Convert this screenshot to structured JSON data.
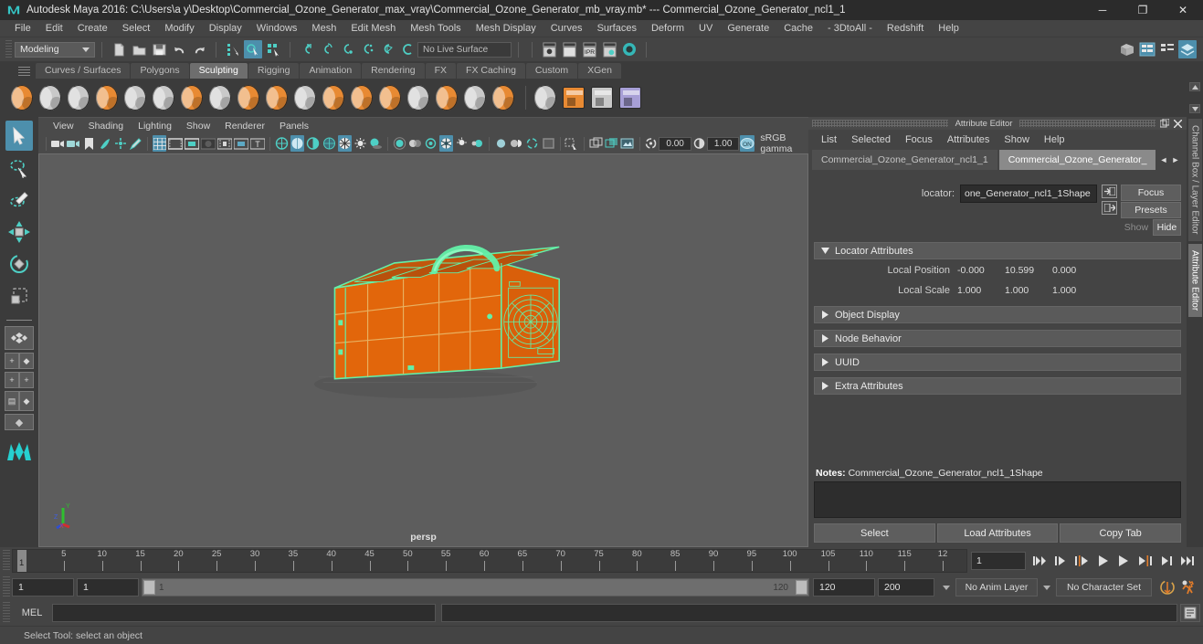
{
  "titlebar": {
    "app_icon": "maya-logo-icon",
    "title": "Autodesk Maya 2016: C:\\Users\\a y\\Desktop\\Commercial_Ozone_Generator_max_vray\\Commercial_Ozone_Generator_mb_vray.mb*  ---  Commercial_Ozone_Generator_ncl1_1",
    "minimize": "─",
    "maximize": "❐",
    "close": "✕"
  },
  "menubar": {
    "items": [
      "File",
      "Edit",
      "Create",
      "Select",
      "Modify",
      "Display",
      "Windows",
      "Mesh",
      "Edit Mesh",
      "Mesh Tools",
      "Mesh Display",
      "Curves",
      "Surfaces",
      "Deform",
      "UV",
      "Generate",
      "Cache",
      "- 3DtoAll -",
      "Redshift",
      "Help"
    ]
  },
  "statusline": {
    "mode": "Modeling",
    "live_surface": "No Live Surface",
    "icons": [
      "new-scene-icon",
      "open-scene-icon",
      "save-scene-icon",
      "undo-icon",
      "redo-icon",
      "select-hierarchy-icon",
      "select-object-icon",
      "select-component-icon",
      "snap-grid-icon",
      "snap-curve-icon",
      "snap-point-icon",
      "snap-projected-icon",
      "snap-view-plane-icon",
      "make-live-icon",
      "render-view-icon",
      "render-current-frame-icon",
      "ipr-render-icon",
      "render-settings-icon",
      "hypershade-icon",
      "show-hide-editors-icon",
      "channel-box-icon",
      "attribute-editor-icon",
      "tool-settings-icon"
    ]
  },
  "shelf": {
    "tabs": [
      "Curves / Surfaces",
      "Polygons",
      "Sculpting",
      "Rigging",
      "Animation",
      "Rendering",
      "FX",
      "FX Caching",
      "Custom",
      "XGen"
    ],
    "active_tab": "Sculpting",
    "tools": [
      {
        "name": "sculpt-brush-icon",
        "color": "#e88a33"
      },
      {
        "name": "smooth-brush-icon",
        "color": "#c9c9c9"
      },
      {
        "name": "relax-brush-icon",
        "color": "#c9c9c9"
      },
      {
        "name": "grab-brush-icon",
        "color": "#e88a33"
      },
      {
        "name": "pinch-brush-icon",
        "color": "#c9c9c9"
      },
      {
        "name": "flatten-brush-icon",
        "color": "#c9c9c9"
      },
      {
        "name": "foamy-brush-icon",
        "color": "#e88a33"
      },
      {
        "name": "spray-brush-icon",
        "color": "#c9c9c9"
      },
      {
        "name": "repeat-brush-icon",
        "color": "#e88a33"
      },
      {
        "name": "imprint-brush-icon",
        "color": "#e88a33"
      },
      {
        "name": "wax-brush-icon",
        "color": "#c9c9c9"
      },
      {
        "name": "scrape-brush-icon",
        "color": "#e88a33"
      },
      {
        "name": "fill-brush-icon",
        "color": "#e88a33"
      },
      {
        "name": "knife-brush-icon",
        "color": "#e88a33"
      },
      {
        "name": "smear-brush-icon",
        "color": "#c9c9c9"
      },
      {
        "name": "bulge-brush-icon",
        "color": "#e88a33"
      },
      {
        "name": "amplify-brush-icon",
        "color": "#c9c9c9"
      },
      {
        "name": "freeze-brush-icon",
        "color": "#e88a33"
      },
      {
        "name": "convert-sculpt-icon",
        "color": "#c9c9c9"
      },
      {
        "name": "sculpt-settings-icon",
        "color": "#e88a33"
      },
      {
        "name": "mirror-sculpt-icon",
        "color": "#c9c9c9"
      },
      {
        "name": "sculpt-layers-icon",
        "color": "#a79fd6"
      }
    ]
  },
  "toolbox": {
    "items": [
      {
        "name": "select-tool",
        "active": true
      },
      {
        "name": "lasso-select-tool",
        "active": false
      },
      {
        "name": "paint-select-tool",
        "active": false
      },
      {
        "name": "move-tool",
        "active": false
      },
      {
        "name": "rotate-tool",
        "active": false
      },
      {
        "name": "scale-tool",
        "active": false
      }
    ],
    "layouts": [
      "single-perspective-layout",
      "four-view-layout",
      "outliner-persp-layout",
      "persp-graph-layout",
      "hypershade-persp-layout",
      "two-stacked-layout",
      "maya-logo-watermark"
    ]
  },
  "viewport": {
    "menus": [
      "View",
      "Shading",
      "Lighting",
      "Show",
      "Renderer",
      "Panels"
    ],
    "exposure": "0.00",
    "gamma_value": "1.00",
    "color_space": "sRGB gamma",
    "camera_label": "persp",
    "axis": {
      "x": "X",
      "y": "Y",
      "z": "Z"
    },
    "model_colors": {
      "surface": "#e2660b",
      "wireframe": "#63f0a8",
      "background": "#5d5d5d"
    },
    "toolbar_icons": [
      "select-camera-icon",
      "lock-camera-icon",
      "bookmark-icon",
      "image-plane-icon",
      "two-d-pan-zoom-icon",
      "grease-pencil-icon",
      "grid-toggle-icon",
      "film-gate-icon",
      "resolution-gate-icon",
      "gate-mask-icon",
      "film-origin-icon",
      "safe-action-icon",
      "safe-title-icon",
      "wireframe-shade-icon",
      "smooth-shade-icon",
      "shade-flat-icon",
      "wireframe-on-shaded-icon",
      "texture-icon",
      "lights-icon",
      "shadows-icon",
      "screen-space-ao-icon",
      "motion-blur-icon",
      "multisample-icon",
      "isolate-select-icon",
      "xray-icon",
      "xray-joints-icon",
      "xray-active-icon",
      "exposure-icon",
      "gamma-icon",
      "view-transform-icon"
    ]
  },
  "attribute_editor": {
    "panel_title": "Attribute Editor",
    "float_icon": "undock-icon",
    "close_icon": "close-icon",
    "menus": [
      "List",
      "Selected",
      "Focus",
      "Attributes",
      "Show",
      "Help"
    ],
    "tabs": [
      {
        "label": "Commercial_Ozone_Generator_ncl1_1",
        "active": false
      },
      {
        "label": "Commercial_Ozone_Generator_",
        "active": true
      }
    ],
    "tab_prev": "◄",
    "tab_next": "►",
    "node_type_label": "locator:",
    "node_name": "one_Generator_ncl1_1Shape",
    "focus_button": "Focus",
    "presets_button": "Presets",
    "show_button": "Show",
    "hide_button": "Hide",
    "sections": [
      {
        "label": "Locator Attributes",
        "expanded": true
      },
      {
        "label": "Object Display",
        "expanded": false
      },
      {
        "label": "Node Behavior",
        "expanded": false
      },
      {
        "label": "UUID",
        "expanded": false
      },
      {
        "label": "Extra Attributes",
        "expanded": false
      }
    ],
    "attributes": [
      {
        "label": "Local Position",
        "values": [
          "-0.000",
          "10.599",
          "0.000"
        ]
      },
      {
        "label": "Local Scale",
        "values": [
          "1.000",
          "1.000",
          "1.000"
        ]
      }
    ],
    "notes_label": "Notes:",
    "notes_target": "Commercial_Ozone_Generator_ncl1_1Shape",
    "notes_value": "",
    "buttons": [
      "Select",
      "Load Attributes",
      "Copy Tab"
    ]
  },
  "vertical_tabs": [
    {
      "label": "Channel Box / Layer Editor",
      "active": false
    },
    {
      "label": "Attribute Editor",
      "active": true
    }
  ],
  "timeline": {
    "start": 1,
    "end": 120,
    "current_frame": "1",
    "tick_labels": [
      "5",
      "10",
      "15",
      "20",
      "25",
      "30",
      "35",
      "40",
      "45",
      "50",
      "55",
      "60",
      "65",
      "70",
      "75",
      "80",
      "85",
      "90",
      "95",
      "100",
      "105",
      "110",
      "115",
      "12"
    ],
    "current_field": "1",
    "playback_controls": [
      "go-to-start-icon",
      "step-back-keyframe-icon",
      "step-back-frame-icon",
      "play-backwards-icon",
      "play-forwards-icon",
      "step-forward-frame-icon",
      "step-forward-keyframe-icon",
      "go-to-end-icon"
    ]
  },
  "range_slider": {
    "anim_start": "1",
    "range_start": "1",
    "bar_start_label": "1",
    "bar_end_label": "120",
    "range_end": "120",
    "anim_end": "200",
    "anim_layer": "No Anim Layer",
    "character_set": "No Character Set",
    "auto_key_icon": "auto-keyframe-icon",
    "anim_prefs_icon": "animation-preferences-icon"
  },
  "command_line": {
    "label": "MEL",
    "input_value": "",
    "output_value": "",
    "script_editor_icon": "script-editor-icon"
  },
  "status_bar": {
    "message": "Select Tool: select an object"
  },
  "colors": {
    "accent_blue": "#4d8fac",
    "panel_bg": "#444444",
    "shelf_bg": "#3b3b3b",
    "viewport_bg": "#5d5d5d",
    "orange": "#e2660b",
    "green": "#63f0a8"
  }
}
